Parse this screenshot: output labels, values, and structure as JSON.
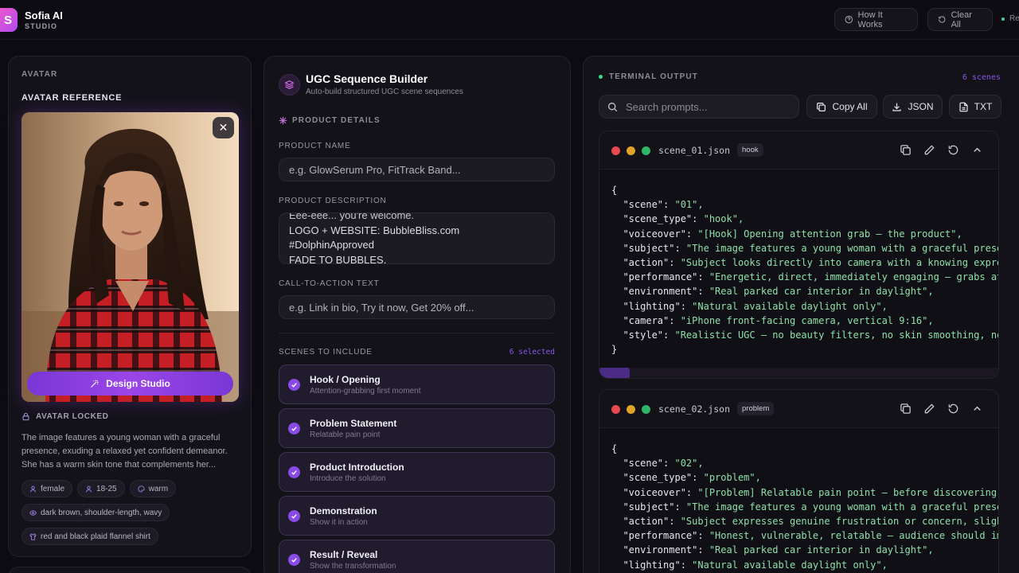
{
  "app": {
    "logo_letter": "S",
    "name": "Sofia AI",
    "sub": "STUDIO"
  },
  "header": {
    "how_it_works": "How It Works",
    "clear_all": "Clear All",
    "status_fragment": "Re"
  },
  "avatar_panel": {
    "section_label": "AVATAR",
    "title": "AVATAR REFERENCE",
    "close": "✕",
    "design_button": "Design Studio",
    "locked_label": "AVATAR LOCKED",
    "description": "The image features a young woman with a graceful presence, exuding a relaxed yet confident demeanor. She has a warm skin tone that complements her...",
    "chips": [
      "female",
      "18-25",
      "warm",
      "dark brown, shoulder-length, wavy",
      "red and black plaid flannel shirt"
    ]
  },
  "builder": {
    "title": "UGC Sequence Builder",
    "subtitle": "Auto-build structured UGC scene sequences",
    "product_details_label": "PRODUCT DETAILS",
    "product_name_label": "PRODUCT NAME",
    "product_name_placeholder": "e.g. GlowSerum Pro, FitTrack Band...",
    "product_description_label": "PRODUCT DESCRIPTION",
    "product_description_lines": [
      "Eee-eee... you're welcome.",
      "LOGO + WEBSITE: BubbleBliss.com",
      "#DolphinApproved",
      "FADE TO BUBBLES."
    ],
    "cta_label": "CALL-TO-ACTION TEXT",
    "cta_placeholder": "e.g. Link in bio, Try it now, Get 20% off...",
    "scenes_label": "SCENES TO INCLUDE",
    "scenes_selected": "6 selected",
    "scenes": [
      {
        "title": "Hook / Opening",
        "sub": "Attention-grabbing first moment"
      },
      {
        "title": "Problem Statement",
        "sub": "Relatable pain point"
      },
      {
        "title": "Product Introduction",
        "sub": "Introduce the solution"
      },
      {
        "title": "Demonstration",
        "sub": "Show it in action"
      },
      {
        "title": "Result / Reveal",
        "sub": "Show the transformation"
      }
    ]
  },
  "terminal": {
    "label": "TERMINAL OUTPUT",
    "scene_count": "6 scenes",
    "search_placeholder": "Search prompts...",
    "copy_all": "Copy All",
    "json": "JSON",
    "txt": "TXT",
    "cards": [
      {
        "filename": "scene_01.json",
        "tag": "hook",
        "lines": [
          [
            "{",
            ""
          ],
          [
            "  \"scene\": ",
            "\"01\","
          ],
          [
            "  \"scene_type\": ",
            "\"hook\","
          ],
          [
            "  \"voiceover\": ",
            "\"[Hook] Opening attention grab — the product\","
          ],
          [
            "  \"subject\": ",
            "\"The image features a young woman with a graceful presence,"
          ],
          [
            "  \"action\": ",
            "\"Subject looks directly into camera with a knowing expression"
          ],
          [
            "  \"performance\": ",
            "\"Energetic, direct, immediately engaging — grabs attention"
          ],
          [
            "  \"environment\": ",
            "\"Real parked car interior in daylight\","
          ],
          [
            "  \"lighting\": ",
            "\"Natural available daylight only\","
          ],
          [
            "  \"camera\": ",
            "\"iPhone front-facing camera, vertical 9:16\","
          ],
          [
            "  \"style\": ",
            "\"Realistic UGC — no beauty filters, no skin smoothing, no glam"
          ],
          [
            "}",
            ""
          ]
        ]
      },
      {
        "filename": "scene_02.json",
        "tag": "problem",
        "lines": [
          [
            "{",
            ""
          ],
          [
            "  \"scene\": ",
            "\"02\","
          ],
          [
            "  \"scene_type\": ",
            "\"problem\","
          ],
          [
            "  \"voiceover\": ",
            "\"[Problem] Relatable pain point — before discovering the s"
          ],
          [
            "  \"subject\": ",
            "\"The image features a young woman with a graceful presence,"
          ],
          [
            "  \"action\": ",
            "\"Subject expresses genuine frustration or concern, slight hea"
          ],
          [
            "  \"performance\": ",
            "\"Honest, vulnerable, relatable — audience should immedi"
          ],
          [
            "  \"environment\": ",
            "\"Real parked car interior in daylight\","
          ],
          [
            "  \"lighting\": ",
            "\"Natural available daylight only\","
          ]
        ]
      }
    ]
  },
  "colors": {
    "accent": "#8a4ae8",
    "background": "#0c0b12",
    "code_string": "#8ee0a8",
    "status_green": "#3dd68c"
  }
}
